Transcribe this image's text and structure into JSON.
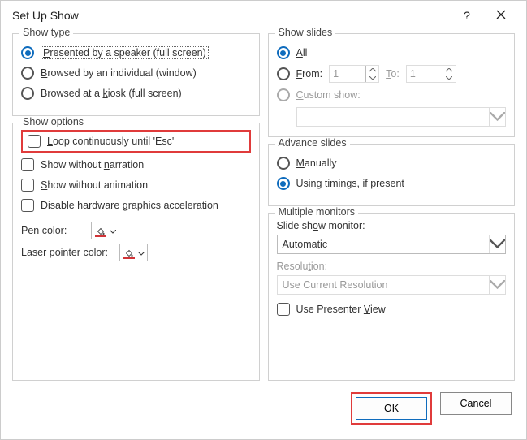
{
  "title": "Set Up Show",
  "groups": {
    "show_type": "Show type",
    "show_slides": "Show slides",
    "show_options": "Show options",
    "advance": "Advance slides",
    "monitors": "Multiple monitors"
  },
  "show_type": {
    "speaker": "Presented by a speaker (full screen)",
    "individual": "Browsed by an individual (window)",
    "kiosk": "Browsed at a kiosk (full screen)"
  },
  "show_slides": {
    "all": "All",
    "from": "From:",
    "from_val": "1",
    "to": "To:",
    "to_val": "1",
    "custom": "Custom show:"
  },
  "options": {
    "loop": "Loop continuously until 'Esc'",
    "no_narration": "Show without narration",
    "no_animation": "Show without animation",
    "no_hw": "Disable hardware graphics acceleration",
    "pen_color": "Pen color:",
    "laser_color": "Laser pointer color:"
  },
  "advance": {
    "manual": "Manually",
    "timings": "Using timings, if present"
  },
  "monitors": {
    "monitor_label": "Slide show monitor:",
    "monitor_val": "Automatic",
    "res_label": "Resolution:",
    "res_val": "Use Current Resolution",
    "presenter": "Use Presenter View"
  },
  "buttons": {
    "ok": "OK",
    "cancel": "Cancel"
  },
  "help_symbol": "?"
}
